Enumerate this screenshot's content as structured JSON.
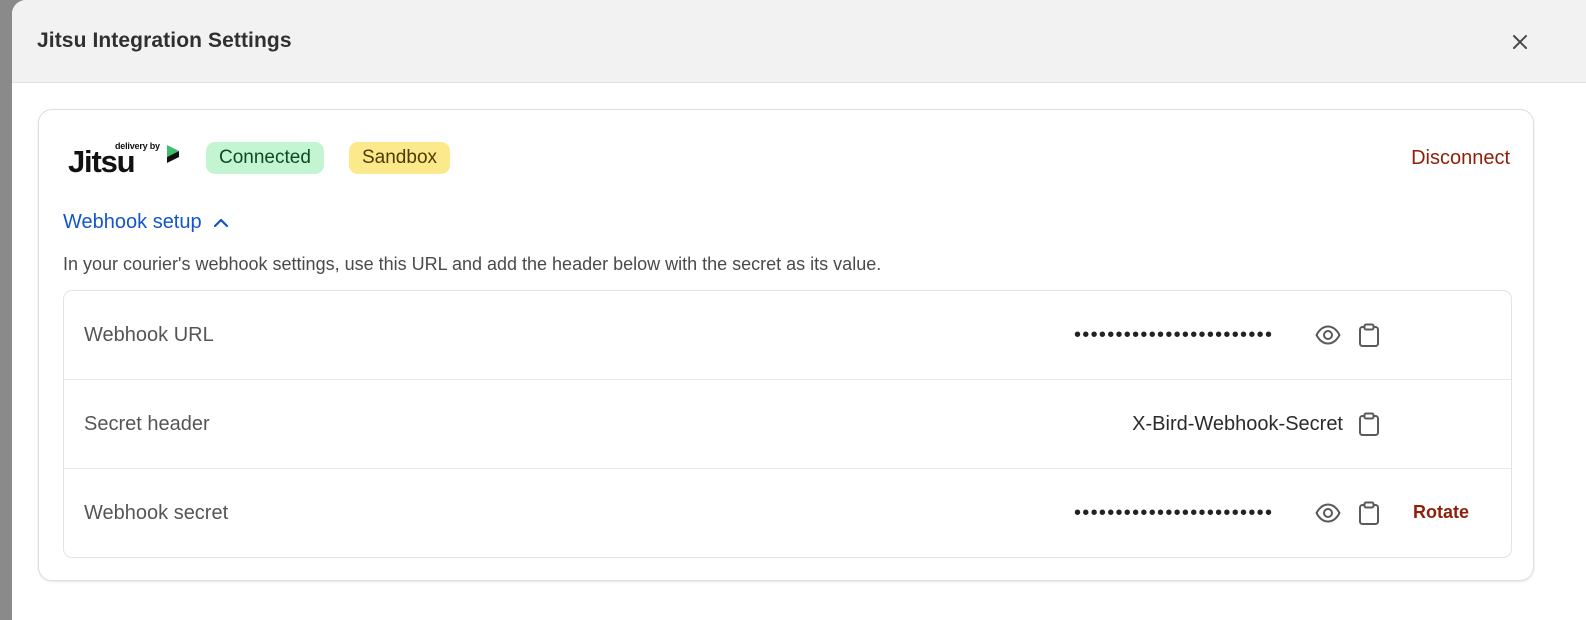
{
  "dialog": {
    "title": "Jitsu Integration Settings"
  },
  "integration": {
    "logo": {
      "tagline": "delivery by",
      "name": "Jitsu",
      "accent_color": "#3fbf6a"
    },
    "badges": {
      "connected": "Connected",
      "sandbox": "Sandbox"
    },
    "disconnect_label": "Disconnect"
  },
  "webhook": {
    "toggle_label": "Webhook setup",
    "expanded": true,
    "description": "In your courier's webhook settings, use this URL and add the header below with the secret as its value.",
    "rows": [
      {
        "label": "Webhook URL",
        "value": "••••••••••••••••••••••••",
        "masked": true
      },
      {
        "label": "Secret header",
        "value": "X-Bird-Webhook-Secret",
        "masked": false
      },
      {
        "label": "Webhook secret",
        "value": "••••••••••••••••••••••••",
        "masked": true,
        "action": "Rotate"
      }
    ]
  },
  "colors": {
    "link": "#1455c9",
    "destructive": "#8e1f0b",
    "connected_bg": "#c4f5d3",
    "sandbox_bg": "#fbe98b"
  }
}
